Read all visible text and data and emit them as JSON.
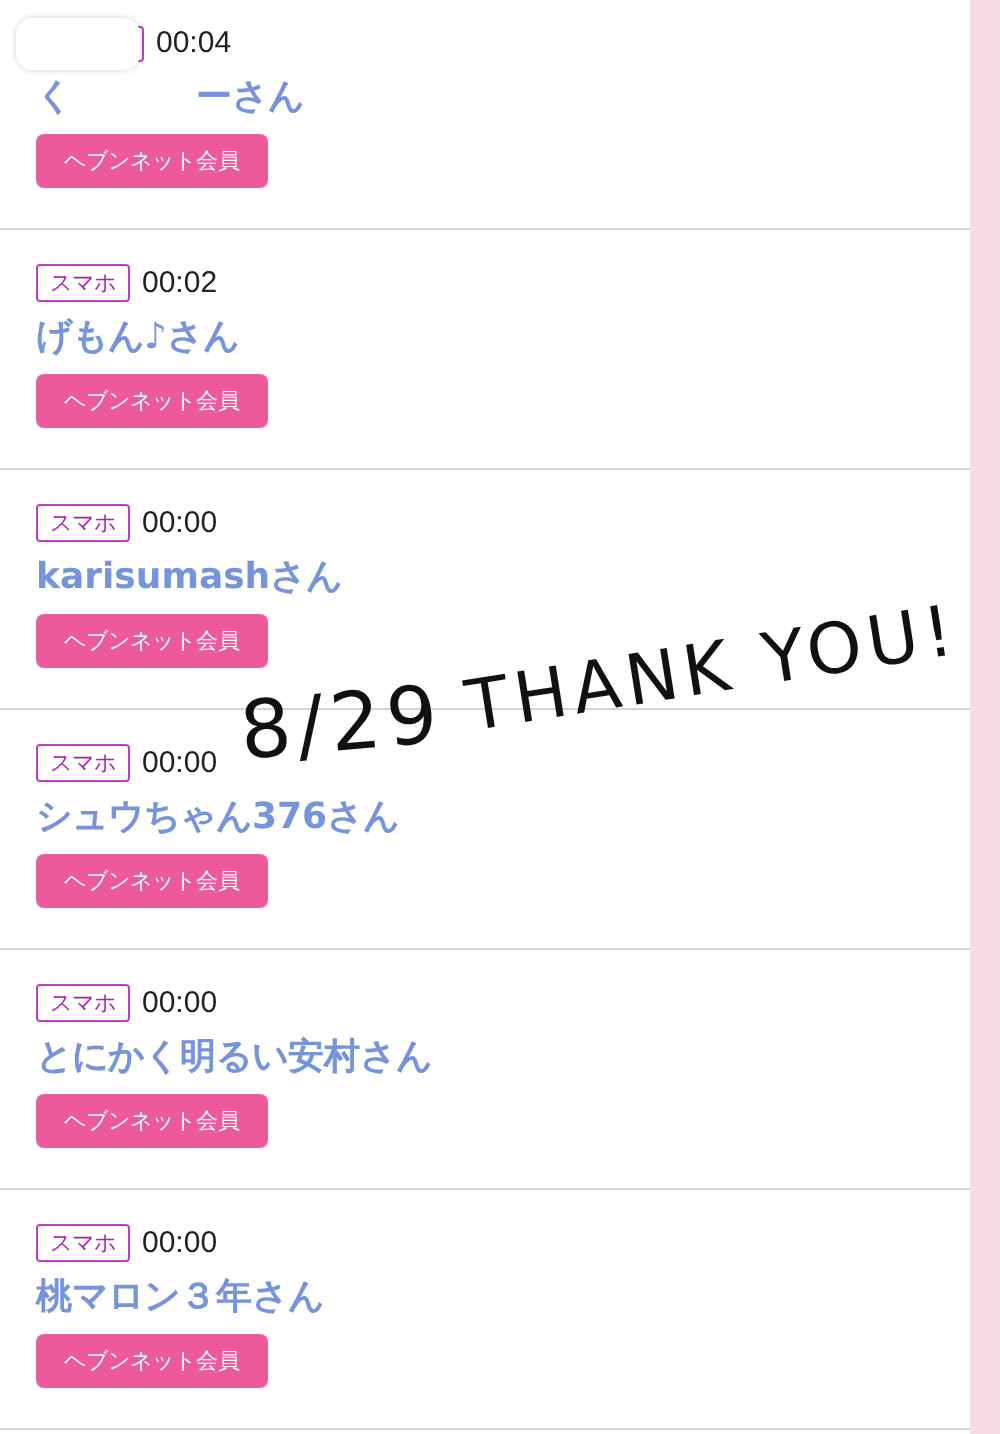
{
  "entries": [
    {
      "kind": "covered",
      "time": "00:04",
      "name_start": "く",
      "name_end": "ーさん",
      "member": "ヘブンネット会員"
    },
    {
      "kind": "normal",
      "device": "スマホ",
      "time": "00:02",
      "name": "げもん♪さん",
      "member": "ヘブンネット会員"
    },
    {
      "kind": "normal",
      "device": "スマホ",
      "time": "00:00",
      "name": "karisumashさん",
      "member": "ヘブンネット会員"
    },
    {
      "kind": "normal",
      "device": "スマホ",
      "time": "00:00",
      "name": "シュウちゃん376さん",
      "member": "ヘブンネット会員"
    },
    {
      "kind": "normal",
      "device": "スマホ",
      "time": "00:00",
      "name": "とにかく明るい安村さん",
      "member": "ヘブンネット会員"
    },
    {
      "kind": "normal",
      "device": "スマホ",
      "time": "00:00",
      "name": "桃マロン３年さん",
      "member": "ヘブンネット会員"
    }
  ],
  "overlay": {
    "date": "8/29",
    "message": "THANK YOU!"
  }
}
